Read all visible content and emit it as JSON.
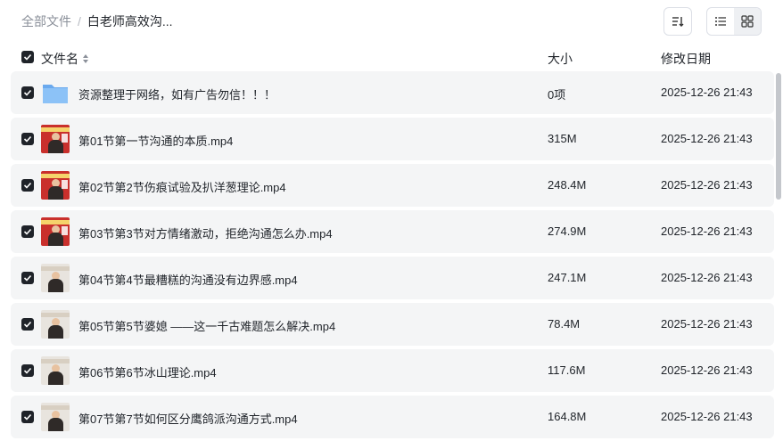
{
  "breadcrumb": {
    "root": "全部文件",
    "separator": "/",
    "current": "白老师高效沟..."
  },
  "toolbar": {
    "sort_icon": "sort-icon",
    "list_view_icon": "list-view-icon",
    "grid_view_icon": "grid-view-icon",
    "active_view": "list"
  },
  "columns": {
    "name": "文件名",
    "size": "大小",
    "modified": "修改日期"
  },
  "files": [
    {
      "name": "资源整理于网络，如有广告勿信！！！",
      "size": "0项",
      "modified": "2025-12-26 21:43",
      "type": "folder",
      "checked": true
    },
    {
      "name": "第01节第一节沟通的本质.mp4",
      "size": "315M",
      "modified": "2025-12-26 21:43",
      "type": "video",
      "checked": true
    },
    {
      "name": "第02节第2节伤痕试验及扒洋葱理论.mp4",
      "size": "248.4M",
      "modified": "2025-12-26 21:43",
      "type": "video",
      "checked": true
    },
    {
      "name": "第03节第3节对方情绪激动，拒绝沟通怎么办.mp4",
      "size": "274.9M",
      "modified": "2025-12-26 21:43",
      "type": "video",
      "checked": true
    },
    {
      "name": "第04节第4节最糟糕的沟通没有边界感.mp4",
      "size": "247.1M",
      "modified": "2025-12-26 21:43",
      "type": "video",
      "checked": true
    },
    {
      "name": "第05节第5节婆媳 ——这一千古难题怎么解决.mp4",
      "size": "78.4M",
      "modified": "2025-12-26 21:43",
      "type": "video",
      "checked": true
    },
    {
      "name": "第06节第6节冰山理论.mp4",
      "size": "117.6M",
      "modified": "2025-12-26 21:43",
      "type": "video",
      "checked": true
    },
    {
      "name": "第07节第7节如何区分鹰鸽派沟通方式.mp4",
      "size": "164.8M",
      "modified": "2025-12-26 21:43",
      "type": "video",
      "checked": true
    }
  ],
  "colors": {
    "row_background": "#f4f5f6",
    "checkbox": "#1f2329",
    "folder": "#7ab8f5"
  }
}
